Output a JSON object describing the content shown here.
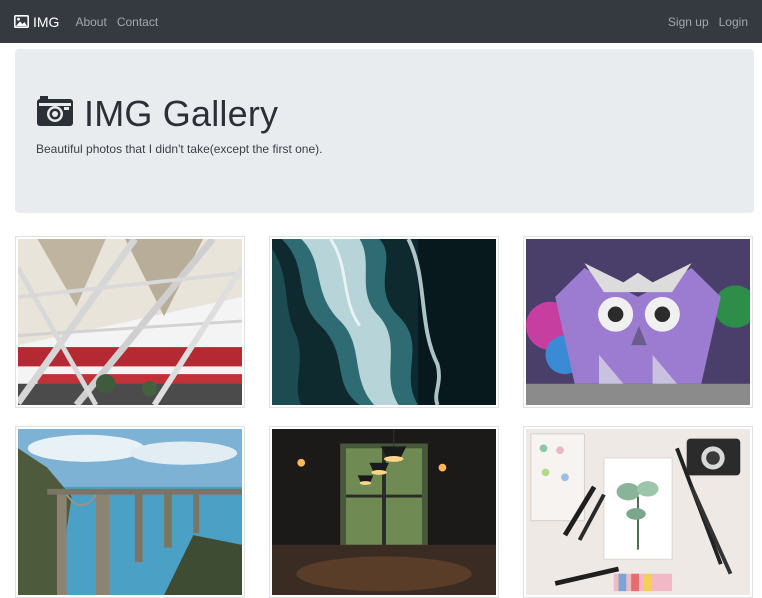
{
  "navbar": {
    "brand": "IMG",
    "left_links": [
      "About",
      "Contact"
    ],
    "right_links": [
      "Sign up",
      "Login"
    ],
    "brand_icon": "image-icon"
  },
  "hero": {
    "icon": "camera-icon",
    "title": "IMG Gallery",
    "subtitle": "Beautiful photos that I didn't take(except the first one)."
  },
  "gallery": {
    "photos": [
      {
        "subject": "stadium-roof"
      },
      {
        "subject": "ocean-waves"
      },
      {
        "subject": "owl-graffiti"
      },
      {
        "subject": "coastal-bridge"
      },
      {
        "subject": "dark-cafe-lamps"
      },
      {
        "subject": "art-supplies-flat-lay"
      }
    ]
  },
  "colors": {
    "navbar": "#343a40",
    "hero_bg": "#e9ecef",
    "border": "#dee2e6"
  }
}
